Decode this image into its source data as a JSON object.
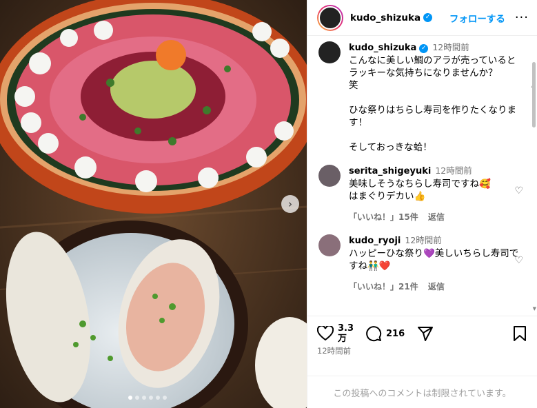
{
  "post": {
    "author": "kudo_shizuka",
    "follow_label": "フォローする",
    "caption_time": "12時間前",
    "caption": "こんなに美しい鯛のアラが売っているとラッキーな気持ちになりませんか？\n笑\n\nひな祭りはちらし寿司を作りたくなります！\n\nそしておっきな蛤！",
    "like_count_line1": "3.3",
    "like_count_line2": "万",
    "comment_count": "216",
    "posted_time": "12時間前",
    "comments_disabled": "この投稿へのコメントは制限されています。"
  },
  "comments": [
    {
      "user": "serita_shigeyuki",
      "time": "12時間前",
      "text": "美味しそうなちらし寿司ですね🥰\nはまぐりデカい👍",
      "likes": "「いいね！」15件",
      "reply": "返信"
    },
    {
      "user": "kudo_ryoji",
      "time": "12時間前",
      "text": "ハッピーひな祭り💜美しいちらし寿司ですね👬❤️",
      "likes": "「いいね！」21件",
      "reply": "返信"
    }
  ],
  "carousel": {
    "slides": 6,
    "active_index": 0
  },
  "colors": {
    "accent": "#0095f6",
    "meta": "#737373"
  },
  "icons": [
    "verified-icon",
    "more-icon",
    "heart-icon",
    "comment-icon",
    "share-icon",
    "save-icon",
    "chevron-right-icon"
  ]
}
